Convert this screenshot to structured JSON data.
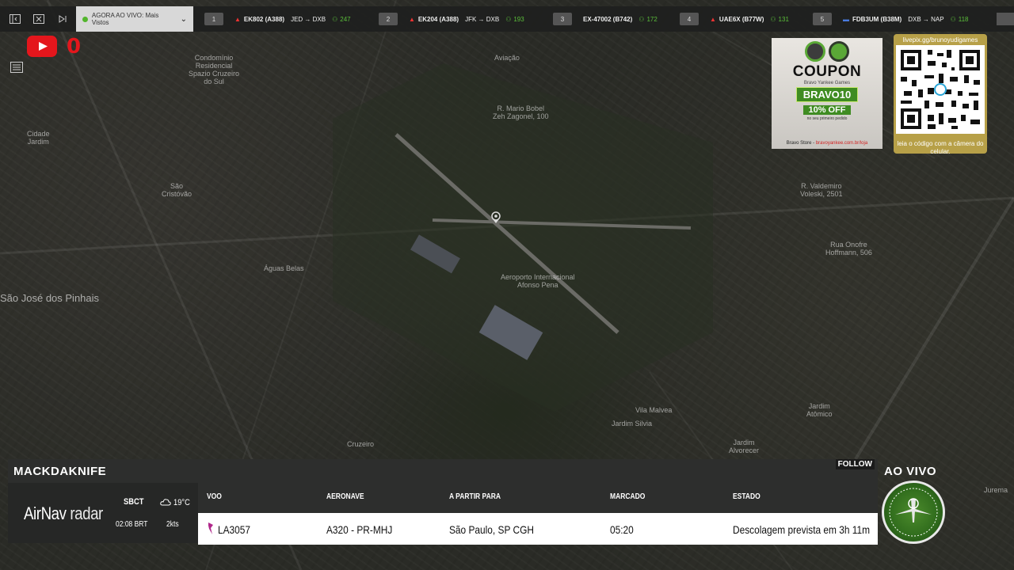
{
  "topbar": {
    "live_tab_label": "AGORA AO VIVO: Mais Vistos",
    "flights": [
      {
        "num": "1",
        "callsign": "EK802 (A388)",
        "route": "JED → DXB",
        "count": "247"
      },
      {
        "num": "2",
        "callsign": "EK204 (A388)",
        "route": "JFK → DXB",
        "count": "193"
      },
      {
        "num": "3",
        "callsign": "EX-47002 (B742)",
        "route": "",
        "count": "172"
      },
      {
        "num": "4",
        "callsign": "UAE6X (B77W)",
        "route": "",
        "count": "131"
      },
      {
        "num": "5",
        "callsign": "FDB3UM (B38M)",
        "route": "DXB → NAP",
        "count": "118"
      }
    ]
  },
  "youtube": {
    "count": "0"
  },
  "map": {
    "labels": [
      {
        "text": "Condomínio\nResidencial\nSpazio Cruzeiro\ndo Sul"
      },
      {
        "text": "Aviação"
      },
      {
        "text": "R. Mario Bobel\nZeh Zagonel, 100"
      },
      {
        "text": "Cidade\nJardim"
      },
      {
        "text": "São\nCristóvão"
      },
      {
        "text": "Águas Belas"
      },
      {
        "text": "São José dos Pinhais"
      },
      {
        "text": "Aeroporto Internacional\nAfonso Pena"
      },
      {
        "text": "Jardim Silvia"
      },
      {
        "text": "Vila Malvea"
      },
      {
        "text": "Jardim\nAtômico"
      },
      {
        "text": "Jardim\nAlvorecer"
      },
      {
        "text": "Cruzeiro"
      },
      {
        "text": "Jurema"
      },
      {
        "text": "R. Valdemiro\nVoleski, 2501"
      },
      {
        "text": "Rua Onofre\nHoffmann, 506"
      }
    ]
  },
  "coupon": {
    "title": "COUPON",
    "small1": "Bravo Yankee Games",
    "code": "BRAVO10",
    "off": "10% OFF",
    "small2": "no seu primeiro pedido",
    "footer_a": "Bravo Store - ",
    "footer_b": "bravoyankee.com.br/loja"
  },
  "qr": {
    "url": "livepix.gg/brunoyudigames",
    "caption": "leia o código com a câmera do celular."
  },
  "panel": {
    "callsign": "MACKDAKNIFE",
    "follow": "FOLLOW",
    "brand": {
      "name": "AirNav",
      "suffix": " radar"
    },
    "icao": "SBCT",
    "time": "02:08 BRT",
    "temp": "19°C",
    "wind": "2kts",
    "headers": {
      "flight": "VOO",
      "aircraft": "AERONAVE",
      "route": "A PARTIR PARA",
      "scheduled": "MARCADO",
      "status": "ESTADO"
    },
    "row": {
      "flight": "LA3057",
      "aircraft": "A320 - PR-MHJ",
      "route": "São Paulo, SP CGH",
      "scheduled": "05:20",
      "status": "Descolagem prevista em 3h 11m"
    }
  },
  "badge": {
    "aovivo": "AO VIVO"
  },
  "colors": {
    "accent_green": "#5bbf3a",
    "youtube_red": "#e4161c",
    "airline_flag": "#b0268a"
  }
}
